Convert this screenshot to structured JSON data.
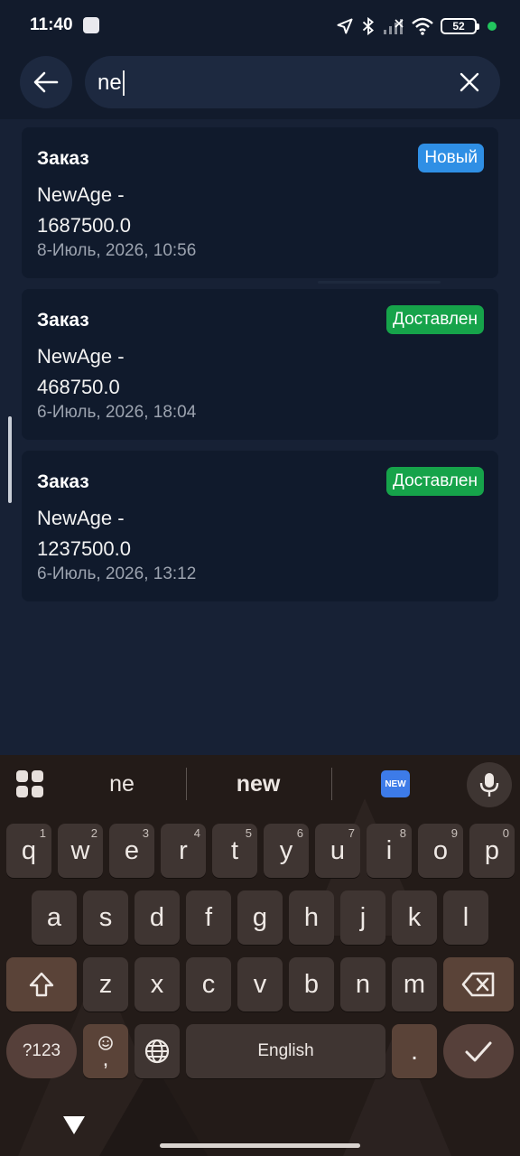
{
  "status_bar": {
    "time": "11:40",
    "battery_level": "52",
    "icons": [
      "location-arrow-icon",
      "bluetooth-icon",
      "signal-icon",
      "wifi-icon",
      "battery-icon"
    ]
  },
  "search": {
    "query": "ne"
  },
  "orders": [
    {
      "title": "Заказ",
      "name": "NewAge - 1687500.0",
      "date": "8-Июль, 2026, 10:56",
      "status": "Новый",
      "status_color": "#2f8fe5"
    },
    {
      "title": "Заказ",
      "name": "NewAge - 468750.0",
      "date": "6-Июль, 2026, 18:04",
      "status": "Доставлен",
      "status_color": "#16a34a"
    },
    {
      "title": "Заказ",
      "name": "NewAge - 1237500.0",
      "date": "6-Июль, 2026, 13:12",
      "status": "Доставлен",
      "status_color": "#16a34a"
    }
  ],
  "keyboard": {
    "suggestions": [
      "ne",
      "new"
    ],
    "emoji_label": "NEW",
    "row1": [
      {
        "key": "q",
        "sup": "1"
      },
      {
        "key": "w",
        "sup": "2"
      },
      {
        "key": "e",
        "sup": "3"
      },
      {
        "key": "r",
        "sup": "4"
      },
      {
        "key": "t",
        "sup": "5"
      },
      {
        "key": "y",
        "sup": "6"
      },
      {
        "key": "u",
        "sup": "7"
      },
      {
        "key": "i",
        "sup": "8"
      },
      {
        "key": "o",
        "sup": "9"
      },
      {
        "key": "p",
        "sup": "0"
      }
    ],
    "row2": [
      "a",
      "s",
      "d",
      "f",
      "g",
      "h",
      "j",
      "k",
      "l"
    ],
    "row3": [
      "z",
      "x",
      "c",
      "v",
      "b",
      "n",
      "m"
    ],
    "symbols_label": "?123",
    "comma_label": ",",
    "space_label": "English",
    "period_label": "."
  }
}
